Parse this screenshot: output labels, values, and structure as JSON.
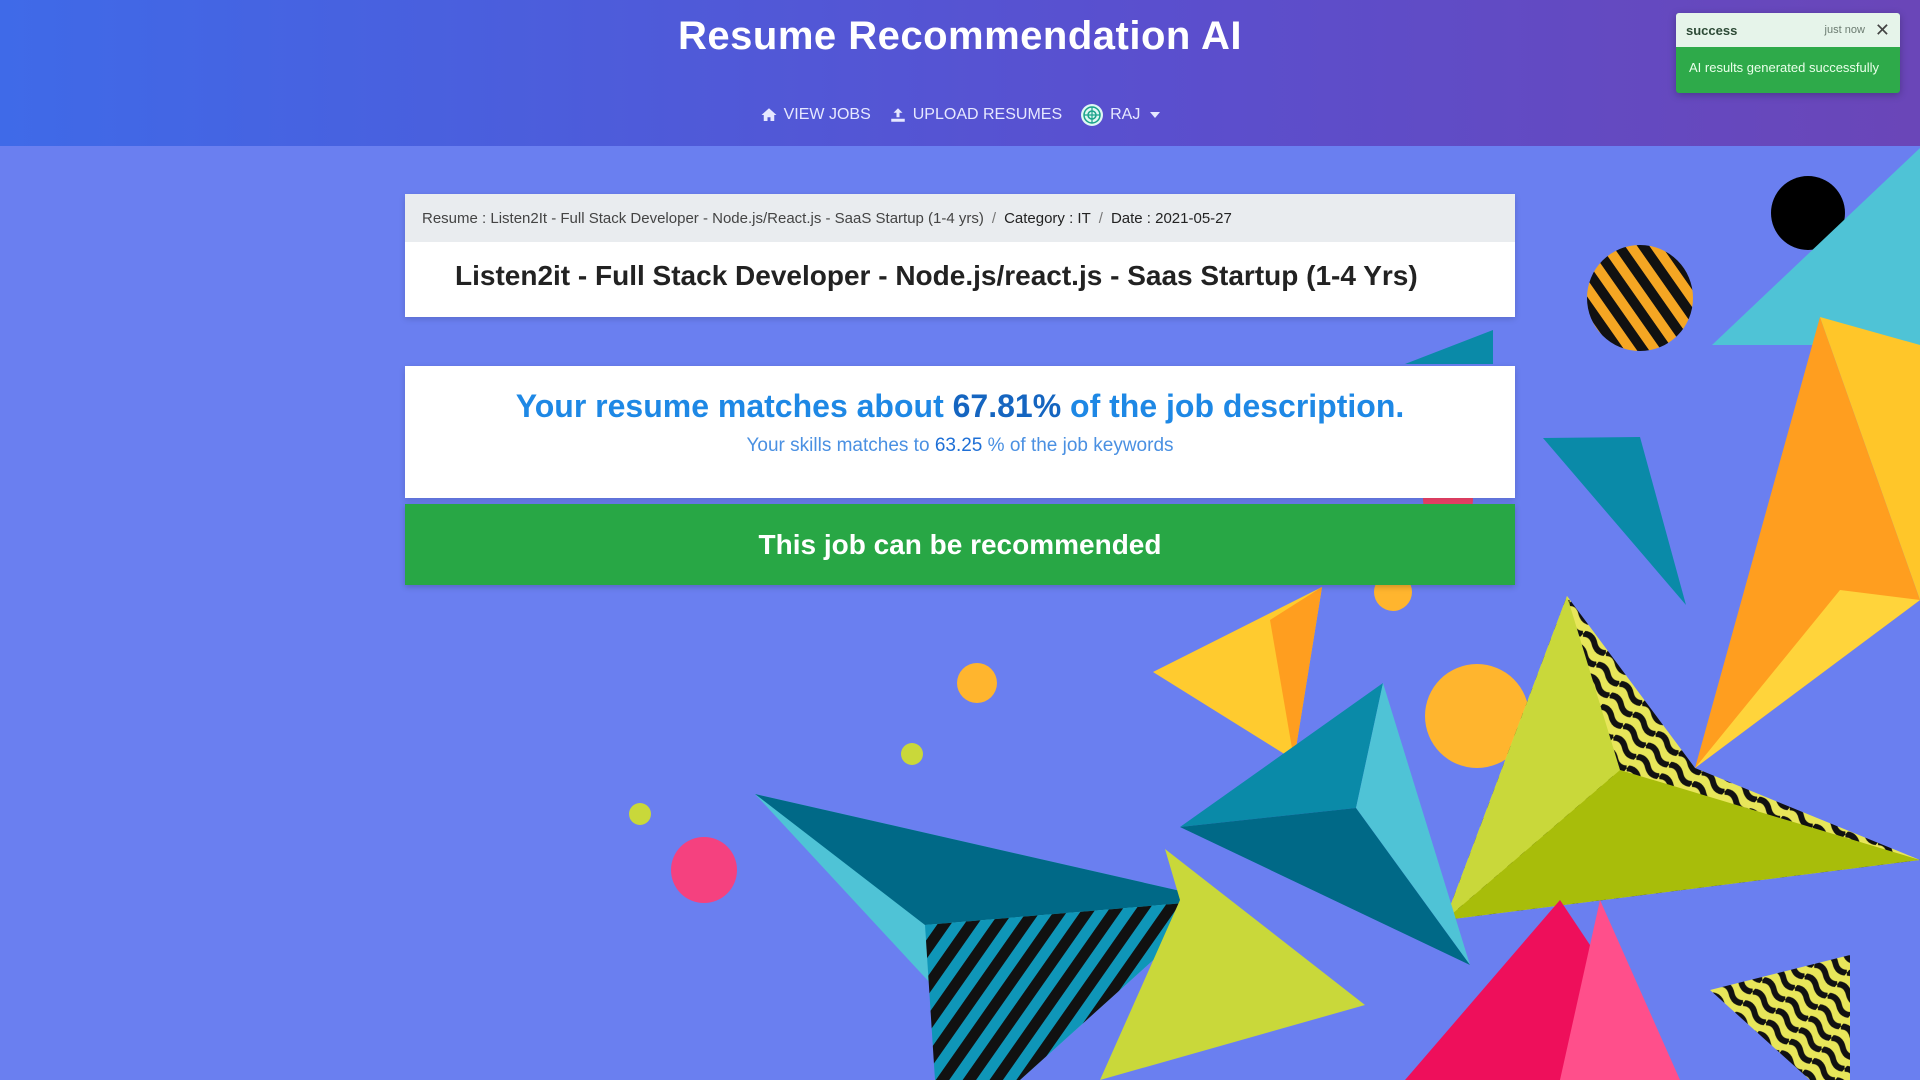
{
  "header": {
    "brand": "Resume Recommendation AI",
    "nav": [
      {
        "label": "VIEW JOBS",
        "icon": "home-icon"
      },
      {
        "label": "UPLOAD RESUMES",
        "icon": "upload-icon"
      },
      {
        "label": "RAJ",
        "icon": "user-avatar-icon"
      }
    ]
  },
  "breadcrumb": {
    "resume": "Resume : Listen2It - Full Stack Developer - Node.js/React.js - SaaS Startup (1-4 yrs)",
    "category": "Category : IT",
    "date": "Date : 2021-05-27",
    "separator": "/"
  },
  "job": {
    "title": "Listen2it - Full Stack Developer - Node.js/react.js - Saas Startup (1-4 Yrs)"
  },
  "match": {
    "prefix": "Your resume matches about",
    "percent": "67.81%",
    "suffix": "of the job description.",
    "skills_prefix": "Your skills matches to",
    "skills_percent": "63.25",
    "skills_suffix": "% of the job keywords"
  },
  "recommendation": {
    "text": "This job can be recommended"
  },
  "toast": {
    "title": "success",
    "time": "just now",
    "message": "AI results generated successfully"
  },
  "colors": {
    "header_start": "#3f6ae8",
    "header_end": "#6a46b8",
    "background": "#6a7ff0",
    "recommend": "#28a745",
    "accent_blue": "#1e88e5"
  }
}
